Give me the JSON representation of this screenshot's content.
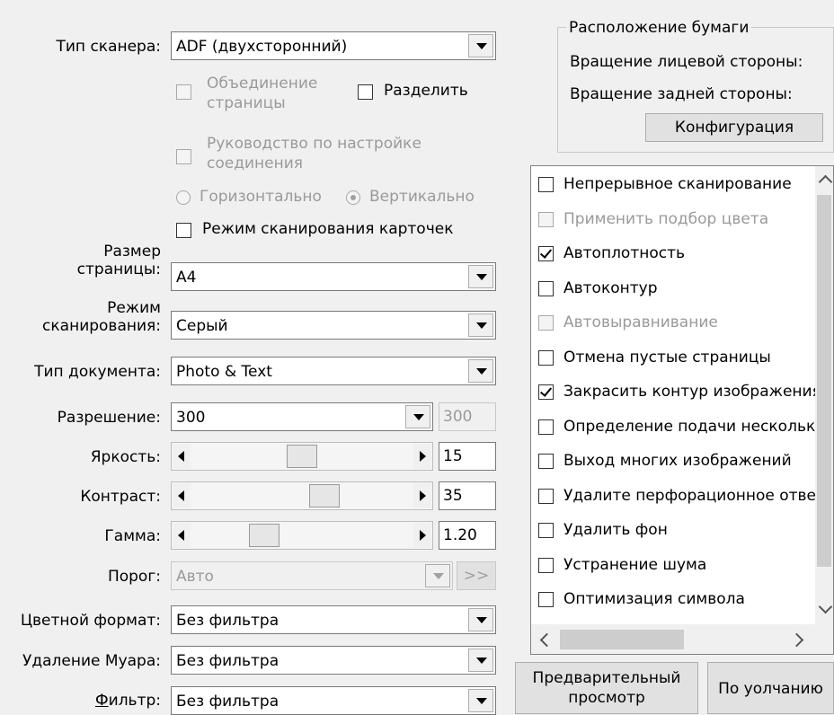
{
  "left": {
    "scanner_type": {
      "label": "Тип сканера:",
      "value": "ADF (двухсторонний)"
    },
    "merge_pages": {
      "label": "Объединение страницы"
    },
    "split": {
      "label": "Разделить"
    },
    "connection_guide": {
      "label": "Руководство по настройке соединения"
    },
    "orientation": {
      "horizontal": "Горизонтально",
      "vertical": "Вертикально",
      "selected": "Вертикально"
    },
    "card_mode": {
      "label": "Режим сканирования карточек"
    },
    "page_size": {
      "label_line1": "Размер",
      "label_line2": "страницы:",
      "value": "A4"
    },
    "scan_mode": {
      "label_line1": "Режим",
      "label_line2": "сканирования:",
      "value": "Серый"
    },
    "doc_type": {
      "label": "Тип документа:",
      "value": "Photo & Text"
    },
    "resolution": {
      "label": "Разрешение:",
      "value": "300",
      "custom": "300"
    },
    "brightness": {
      "label": "Яркость:",
      "value": "15",
      "level": 0.5
    },
    "contrast": {
      "label": "Контраст:",
      "value": "35",
      "level": 0.62
    },
    "gamma": {
      "label": "Гамма:",
      "value": "1.20",
      "level": 0.3
    },
    "threshold": {
      "label": "Порог:",
      "value": "Авто",
      "button": ">>"
    },
    "color_format": {
      "label": "Цветной формат:",
      "value": "Без фильтра"
    },
    "moire": {
      "label": "Удаление Муара:",
      "value": "Без фильтра"
    },
    "filter": {
      "label_accel": "Ф",
      "label_rest": "ильтр:",
      "value": "Без фильтра"
    }
  },
  "paper": {
    "title": "Расположение бумаги",
    "front_rotation": "Вращение лицевой стороны:",
    "back_rotation": "Вращение задней стороны:",
    "config_button": "Конфигурация"
  },
  "options": [
    {
      "label": "Непрерывное сканирование",
      "checked": false,
      "enabled": true
    },
    {
      "label": "Применить подбор цвета",
      "checked": false,
      "enabled": false
    },
    {
      "label": "Автоплотность",
      "checked": true,
      "enabled": true
    },
    {
      "label": "Автоконтур",
      "checked": false,
      "enabled": true
    },
    {
      "label": "Автовыравнивание",
      "checked": false,
      "enabled": false
    },
    {
      "label": "Отмена пустые страницы",
      "checked": false,
      "enabled": true
    },
    {
      "label": "Закрасить контур изображения",
      "checked": true,
      "enabled": true
    },
    {
      "label": "Определение подачи нескольких",
      "checked": false,
      "enabled": true
    },
    {
      "label": "Выход многих изображений",
      "checked": false,
      "enabled": true
    },
    {
      "label": "Удалите перфорационное отверстие",
      "checked": false,
      "enabled": true
    },
    {
      "label": "Удалить фон",
      "checked": false,
      "enabled": true
    },
    {
      "label": "Устранение шума",
      "checked": false,
      "enabled": true
    },
    {
      "label": "Оптимизация символа",
      "checked": false,
      "enabled": true
    }
  ],
  "buttons": {
    "preview_line1": "Предварительный",
    "preview_line2": "просмотр",
    "default": "По уолчанию"
  }
}
